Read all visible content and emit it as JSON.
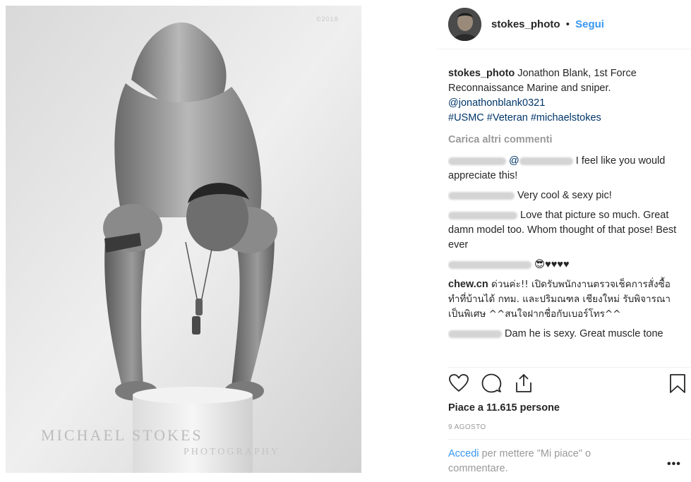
{
  "photo": {
    "copyright": "©2018",
    "watermark_line1": "MICHAEL STOKES",
    "watermark_line2": "PHOTOGRAPHY"
  },
  "header": {
    "username": "stokes_photo",
    "separator": "•",
    "follow_label": "Segui"
  },
  "caption": {
    "username": "stokes_photo",
    "text": "Jonathon Blank, 1st Force Reconnaissance Marine and sniper.",
    "mention": "@jonathonblank0321",
    "hashtags": "#USMC #Veteran #michaelstokes"
  },
  "load_more_label": "Carica altri commenti",
  "comments": [
    {
      "text_before": "@",
      "text_after": " I feel like you would appreciate this!"
    },
    {
      "text": " Very cool & sexy pic!"
    },
    {
      "text": " Love that picture so much. Great damn model too. Whom thought of that pose! Best ever"
    },
    {
      "text": " 😎♥♥♥♥"
    },
    {
      "username": "chew.cn",
      "text": " ด่วนค่ะ!! เปิดรับพนักงานตรวจเช็คการสั่งซื้อ ทำที่บ้านได้ กทม. และปริมณฑล เชียงใหม่ รับพิจารณาเป็นพิเศษ ^^สนใจฝากชื่อกับเบอร์โทร^^"
    },
    {
      "text": " Dam he is sexy. Great muscle tone"
    }
  ],
  "likes": "Piace a 11.615 persone",
  "date": "9 AGOSTO",
  "login": {
    "link_label": "Accedi",
    "text": " per mettere \"Mi piace\" o commentare."
  },
  "more_label": "•••",
  "icons": {
    "like": "heart-icon",
    "comment": "comment-icon",
    "share": "share-icon",
    "save": "bookmark-icon"
  }
}
